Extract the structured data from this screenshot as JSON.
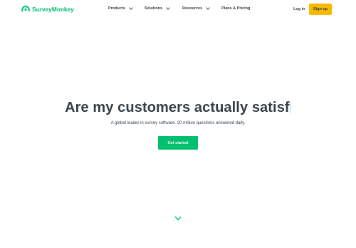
{
  "brand": {
    "name": "SurveyMonkey",
    "color": "#00bf6f"
  },
  "nav": {
    "items": [
      {
        "label": "Products",
        "icon": "chevron-down-icon"
      },
      {
        "label": "Solutions",
        "icon": "chevron-down-icon"
      },
      {
        "label": "Resources",
        "icon": "chevron-down-icon"
      },
      {
        "label": "Plans & Pricing"
      }
    ],
    "login_label": "Log in",
    "signup_label": "Sign up",
    "signup_color": "#f7b800"
  },
  "hero": {
    "title": "Are my customers actually satisf",
    "subtitle": "A global leader in survey software. 20 million questions answered daily.",
    "cta_label": "Get started",
    "scroll_icon": "chevron-down-icon"
  }
}
